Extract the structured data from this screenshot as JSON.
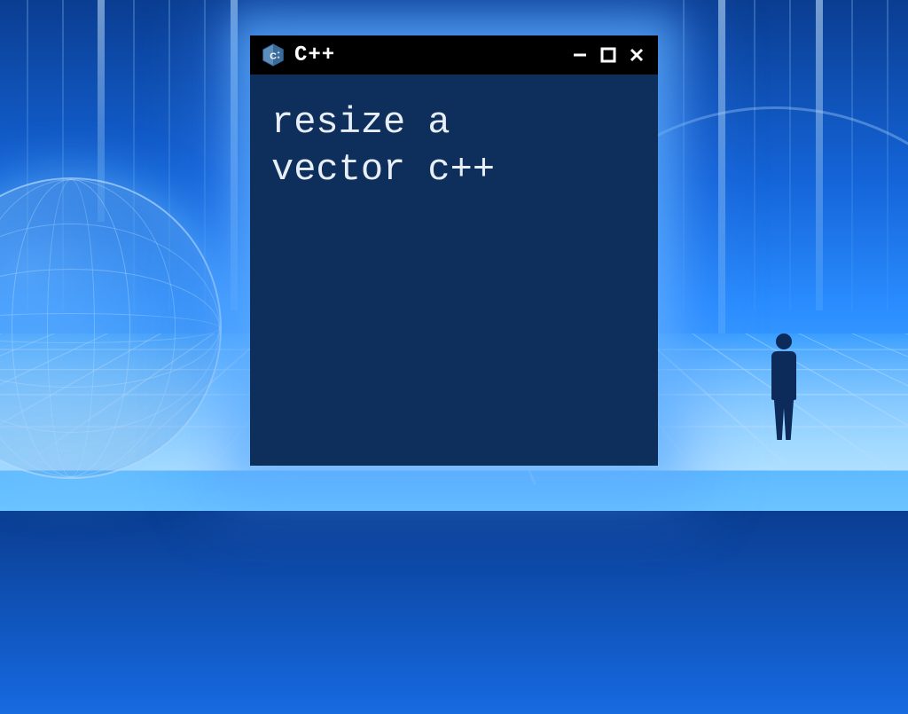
{
  "window": {
    "app_title": "C++",
    "icon_name": "cpp-logo-icon",
    "controls": {
      "minimize": "−",
      "maximize": "□",
      "close": "✕"
    }
  },
  "content": {
    "text": "resize a\nvector c++"
  },
  "colors": {
    "window_bg": "#0e2e5c",
    "titlebar_bg": "#000000",
    "text": "#e8eef5",
    "glow": "#64b4ff"
  }
}
